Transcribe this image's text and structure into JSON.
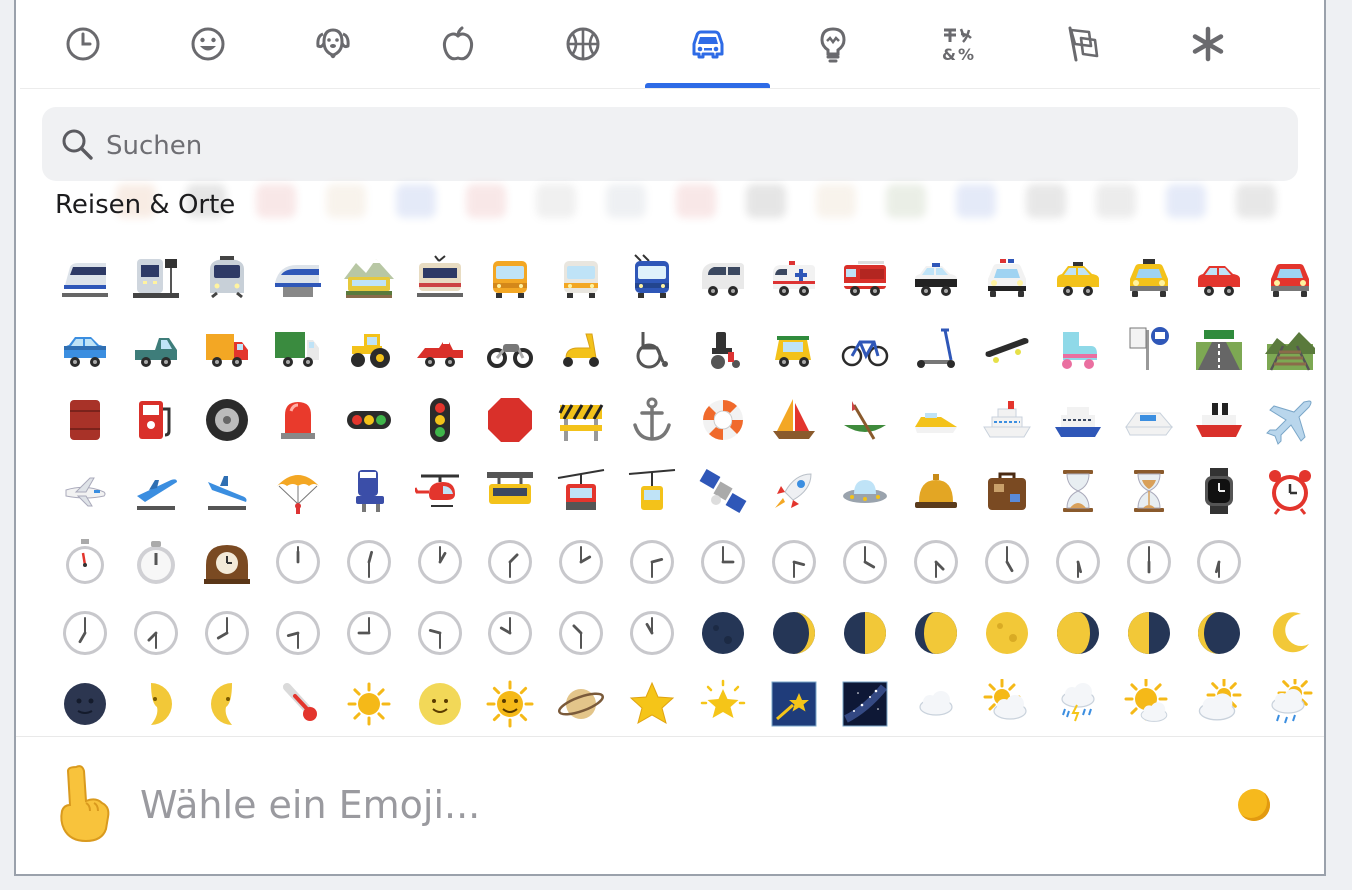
{
  "tabs": [
    {
      "name": "tab-recent",
      "icon": "clock-icon"
    },
    {
      "name": "tab-smileys",
      "icon": "smiley-icon"
    },
    {
      "name": "tab-animals",
      "icon": "dog-icon"
    },
    {
      "name": "tab-food",
      "icon": "apple-icon"
    },
    {
      "name": "tab-activities",
      "icon": "basketball-icon"
    },
    {
      "name": "tab-travel",
      "icon": "car-icon",
      "active": true
    },
    {
      "name": "tab-objects",
      "icon": "lightbulb-icon"
    },
    {
      "name": "tab-symbols",
      "icon": "symbols-icon"
    },
    {
      "name": "tab-flags",
      "icon": "flags-icon"
    },
    {
      "name": "tab-custom",
      "icon": "asterisk-icon"
    }
  ],
  "colors": {
    "accent": "#2e6be6",
    "search_bg": "#f0f1f3",
    "tone": "#f6b91d"
  },
  "search": {
    "placeholder": "Suchen"
  },
  "section": {
    "title": "Reisen & Orte"
  },
  "footer": {
    "placeholder": "Wähle ein Emoji...",
    "preview_icon": "pointing-up-hand-icon",
    "tone_icon": "skin-tone-icon"
  },
  "emoji_rows": [
    [
      "light-rail",
      "station",
      "tram-front",
      "monorail",
      "mountain-railway",
      "tram-car",
      "bus",
      "oncoming-bus",
      "trolleybus",
      "minibus",
      "ambulance",
      "fire-engine",
      "police-car",
      "oncoming-police-car",
      "taxi",
      "oncoming-taxi",
      "automobile",
      "oncoming-automobile"
    ],
    [
      "suv",
      "pickup-truck",
      "delivery-truck",
      "articulated-lorry",
      "tractor",
      "racing-car",
      "motorcycle",
      "motor-scooter",
      "manual-wheelchair",
      "motorized-wheelchair",
      "auto-rickshaw",
      "bicycle",
      "kick-scooter",
      "skateboard",
      "roller-skate",
      "bus-stop",
      "motorway",
      "railway-track"
    ],
    [
      "oil-drum",
      "fuel-pump",
      "wheel",
      "police-light",
      "horizontal-traffic-light",
      "vertical-traffic-light",
      "stop-sign",
      "construction",
      "anchor",
      "ring-buoy",
      "sailboat",
      "canoe",
      "speedboat",
      "passenger-ship",
      "ferry",
      "motor-boat",
      "ship",
      "airplane"
    ],
    [
      "small-airplane",
      "airplane-departure",
      "airplane-arrival",
      "parachute",
      "seat",
      "helicopter",
      "suspension-railway",
      "mountain-cableway",
      "aerial-tramway",
      "satellite",
      "rocket",
      "flying-saucer",
      "bellhop-bell",
      "luggage",
      "hourglass-done",
      "hourglass-flowing",
      "watch",
      "alarm-clock"
    ],
    [
      "stopwatch",
      "timer-clock",
      "mantelpiece-clock",
      "twelve-oclock",
      "twelve-thirty",
      "one-oclock",
      "one-thirty",
      "two-oclock",
      "two-thirty",
      "three-oclock",
      "three-thirty",
      "four-oclock",
      "four-thirty",
      "five-oclock",
      "five-thirty",
      "six-oclock",
      "six-thirty"
    ],
    [
      "seven-oclock",
      "seven-thirty",
      "eight-oclock",
      "eight-thirty",
      "nine-oclock",
      "nine-thirty",
      "ten-oclock",
      "ten-thirty",
      "eleven-oclock",
      "new-moon",
      "waxing-crescent",
      "first-quarter",
      "waxing-gibbous",
      "full-moon",
      "waning-gibbous",
      "last-quarter",
      "waning-crescent",
      "crescent-moon"
    ],
    [
      "new-moon-face",
      "first-quarter-face",
      "last-quarter-face",
      "thermometer",
      "sun",
      "full-moon-face",
      "sun-with-face",
      "ringed-planet",
      "star",
      "glowing-star",
      "shooting-star",
      "milky-way",
      "cloud",
      "sun-behind-cloud",
      "cloud-lightning-rain",
      "sun-behind-small-cloud",
      "sun-behind-large-cloud",
      "sun-behind-rain-cloud"
    ]
  ]
}
